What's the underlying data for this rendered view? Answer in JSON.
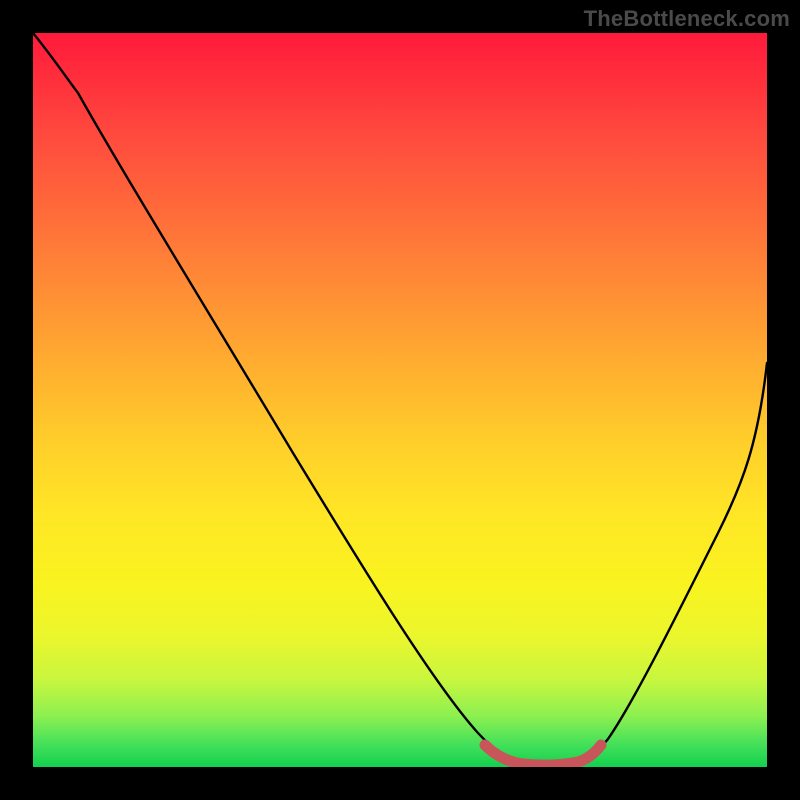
{
  "watermark": "TheBottleneck.com",
  "chart_data": {
    "type": "line",
    "title": "",
    "xlabel": "",
    "ylabel": "",
    "xlim": [
      0,
      100
    ],
    "ylim": [
      0,
      100
    ],
    "grid": false,
    "legend": false,
    "series": [
      {
        "name": "bottleneck-curve",
        "x": [
          0,
          5,
          10,
          15,
          20,
          25,
          30,
          35,
          40,
          45,
          50,
          55,
          60,
          62,
          65,
          68,
          72,
          74,
          76,
          80,
          85,
          90,
          95,
          100
        ],
        "y": [
          100,
          97,
          92,
          85,
          77.5,
          70,
          62.5,
          55,
          47.5,
          40,
          32.5,
          25,
          14,
          8,
          2.5,
          0.5,
          0.3,
          0.5,
          2,
          8,
          19,
          31,
          43,
          56
        ]
      },
      {
        "name": "bottleneck-optimal-band",
        "x": [
          62,
          65,
          68,
          70,
          72,
          74,
          76
        ],
        "y": [
          2.6,
          1.0,
          0.5,
          0.35,
          0.35,
          0.6,
          1.8
        ]
      }
    ],
    "colors": {
      "curve": "#000000",
      "optimal_band": "#c7555a",
      "gradient_top": "#ff1a3c",
      "gradient_bottom": "#13d04e"
    }
  }
}
